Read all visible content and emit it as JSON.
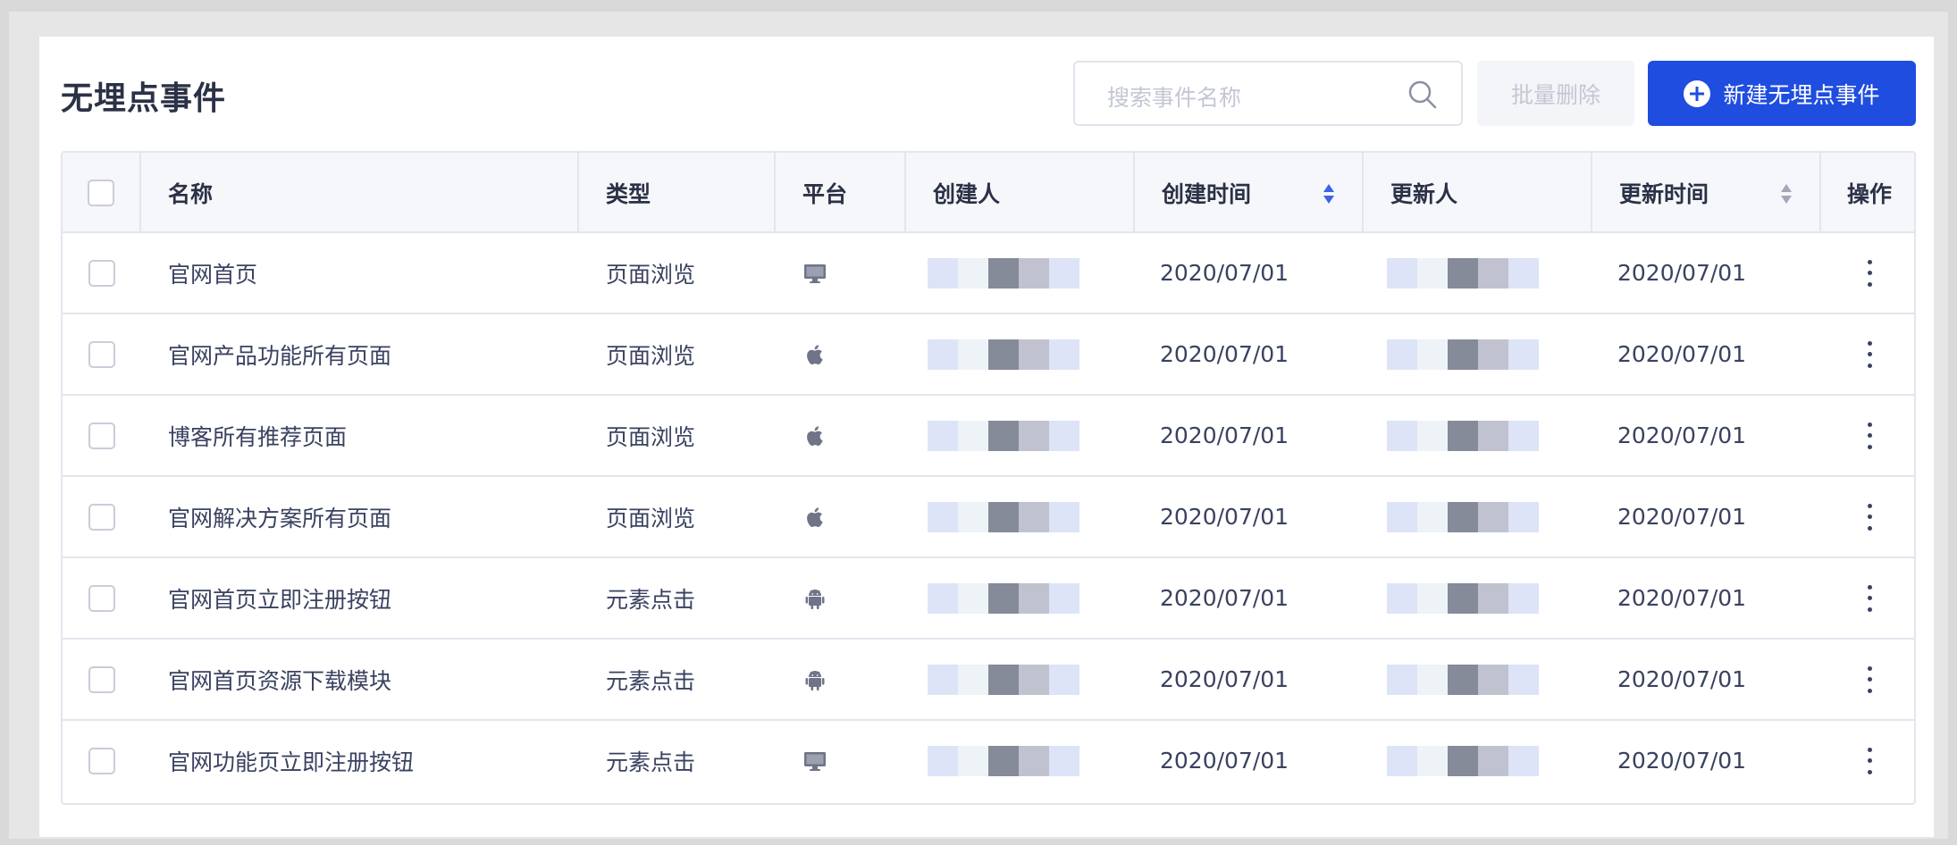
{
  "page": {
    "title": "无埋点事件"
  },
  "toolbar": {
    "search_placeholder": "搜索事件名称",
    "batch_delete_label": "批量删除",
    "new_event_label": "新建无埋点事件"
  },
  "table": {
    "columns": [
      "名称",
      "类型",
      "平台",
      "创建人",
      "创建时间",
      "更新人",
      "更新时间",
      "操作"
    ],
    "rows": [
      {
        "name": "官网首页",
        "type": "页面浏览",
        "platform": "desktop-icon",
        "created_at": "2020/07/01",
        "updated_at": "2020/07/01"
      },
      {
        "name": "官网产品功能所有页面",
        "type": "页面浏览",
        "platform": "apple-icon",
        "created_at": "2020/07/01",
        "updated_at": "2020/07/01"
      },
      {
        "name": "博客所有推荐页面",
        "type": "页面浏览",
        "platform": "apple-icon",
        "created_at": "2020/07/01",
        "updated_at": "2020/07/01"
      },
      {
        "name": "官网解决方案所有页面",
        "type": "页面浏览",
        "platform": "apple-icon",
        "created_at": "2020/07/01",
        "updated_at": "2020/07/01"
      },
      {
        "name": "官网首页立即注册按钮",
        "type": "元素点击",
        "platform": "android-icon",
        "created_at": "2020/07/01",
        "updated_at": "2020/07/01"
      },
      {
        "name": "官网首页资源下载模块",
        "type": "元素点击",
        "platform": "android-icon",
        "created_at": "2020/07/01",
        "updated_at": "2020/07/01"
      },
      {
        "name": "官网功能页立即注册按钮",
        "type": "元素点击",
        "platform": "desktop-icon",
        "created_at": "2020/07/01",
        "updated_at": "2020/07/01"
      }
    ]
  },
  "colors": {
    "accent": "#1f4de0",
    "text": "#2b3146",
    "sort_active": "#3d63e6",
    "sort_inactive": "#a3a8b8",
    "avatar_blocks": [
      "#dde4f8",
      "#eef3f8",
      "#868b99",
      "#c0c3cf",
      "#dde4f8"
    ]
  }
}
